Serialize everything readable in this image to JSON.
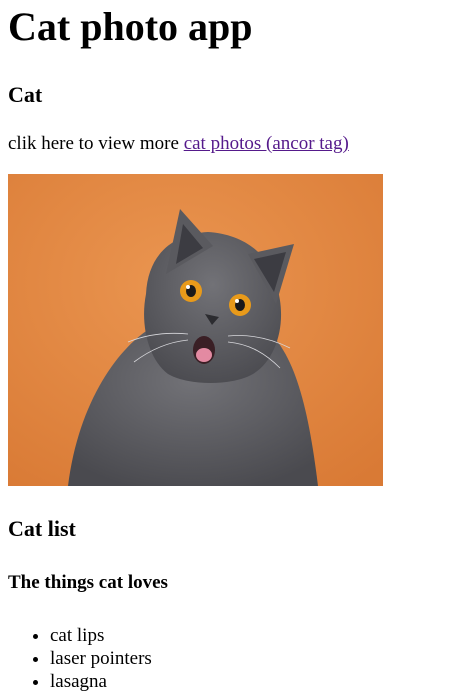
{
  "header": {
    "title": "Cat photo app"
  },
  "section_cat": {
    "heading": "Cat",
    "intro_text": "clik here to view more ",
    "link_text": "cat photos (ancor tag)"
  },
  "photo": {
    "alt": "cat photo",
    "background_color": "#e28a45",
    "fur_color": "#5e5e62",
    "eye_color": "#e89a1a"
  },
  "section_list": {
    "heading": "Cat list",
    "subheading": "The things cat loves",
    "items": [
      "cat lips",
      "laser pointers",
      "lasagna"
    ]
  }
}
